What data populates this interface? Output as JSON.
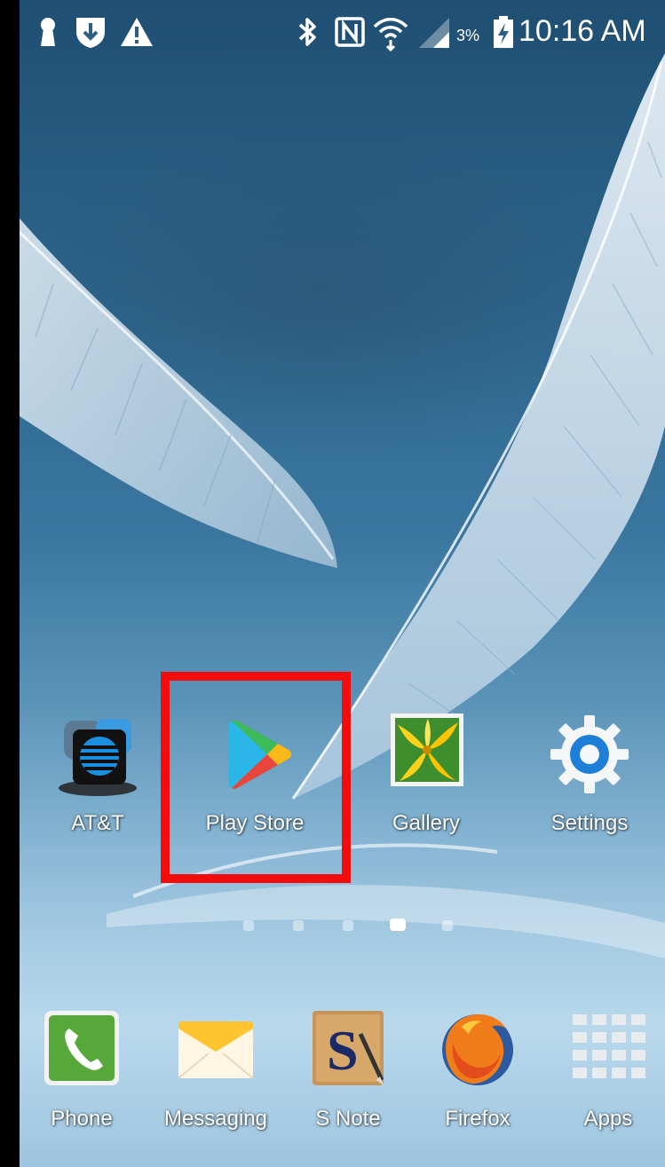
{
  "status_bar": {
    "left_icons": [
      "keyhole-icon",
      "shield-download-icon",
      "warning-icon"
    ],
    "right_icons": [
      "bluetooth-icon",
      "nfc-icon",
      "wifi-icon",
      "signal-icon",
      "battery-charging-icon"
    ],
    "battery_percent": "3%",
    "time": "10:16 AM"
  },
  "home_row": [
    {
      "label": "AT&T",
      "icon": "att-folder-icon"
    },
    {
      "label": "Play Store",
      "icon": "play-store-icon"
    },
    {
      "label": "Gallery",
      "icon": "gallery-icon"
    },
    {
      "label": "Settings",
      "icon": "settings-gear-icon"
    }
  ],
  "page_indicator": {
    "count": 5,
    "active_index": 3
  },
  "dock": [
    {
      "label": "Phone",
      "icon": "phone-icon"
    },
    {
      "label": "Messaging",
      "icon": "messaging-envelope-icon"
    },
    {
      "label": "S Note",
      "icon": "s-note-icon"
    },
    {
      "label": "Firefox",
      "icon": "firefox-icon"
    },
    {
      "label": "Apps",
      "icon": "apps-grid-icon"
    }
  ],
  "colors": {
    "highlight": "#f20c0c",
    "label_text": "#ffffff",
    "wallpaper_top": "#1f4f72",
    "wallpaper_bottom": "#b9d8ec"
  }
}
